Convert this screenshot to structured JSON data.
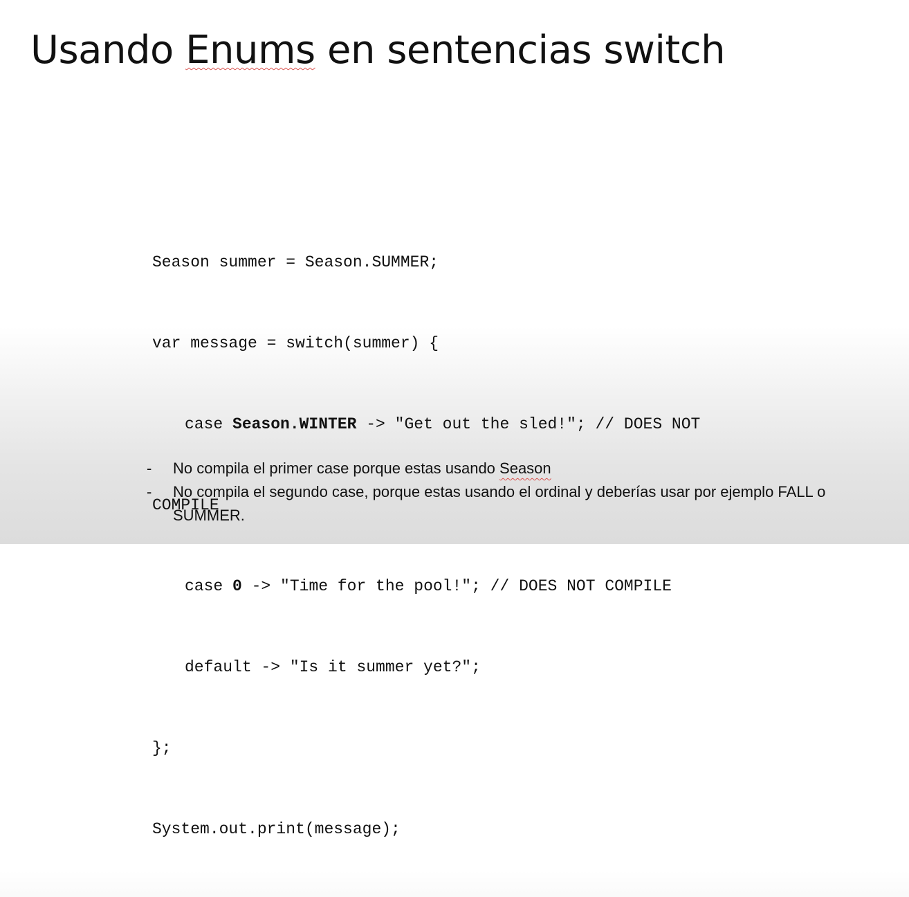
{
  "slide": {
    "title_prefix": "Usando ",
    "title_flagged": "Enums",
    "title_suffix": " en sentencias switch",
    "code": {
      "line1": "Season summer = Season.SUMMER;",
      "line2": "var message = switch(summer) {",
      "line3_pre": "case ",
      "line3_bold": "Season.WINTER",
      "line3_post": " -> \"Get out the sled!\"; // DOES NOT",
      "line4": "COMPILE",
      "line5_pre": "case ",
      "line5_bold": "0",
      "line5_post": " -> \"Time for the pool!\"; // DOES NOT COMPILE",
      "line6": "default -> \"Is it summer yet?\";",
      "line7": "};",
      "line8": "System.out.print(message);"
    },
    "bullets": [
      {
        "dash": "-",
        "text_pre": "No compila el primer case porque estas usando ",
        "text_flagged": "Season"
      },
      {
        "dash": "-",
        "text": "No compila el segundo case, porque estas usando el ordinal y deberías usar por ejemplo FALL o SUMMER."
      }
    ]
  }
}
